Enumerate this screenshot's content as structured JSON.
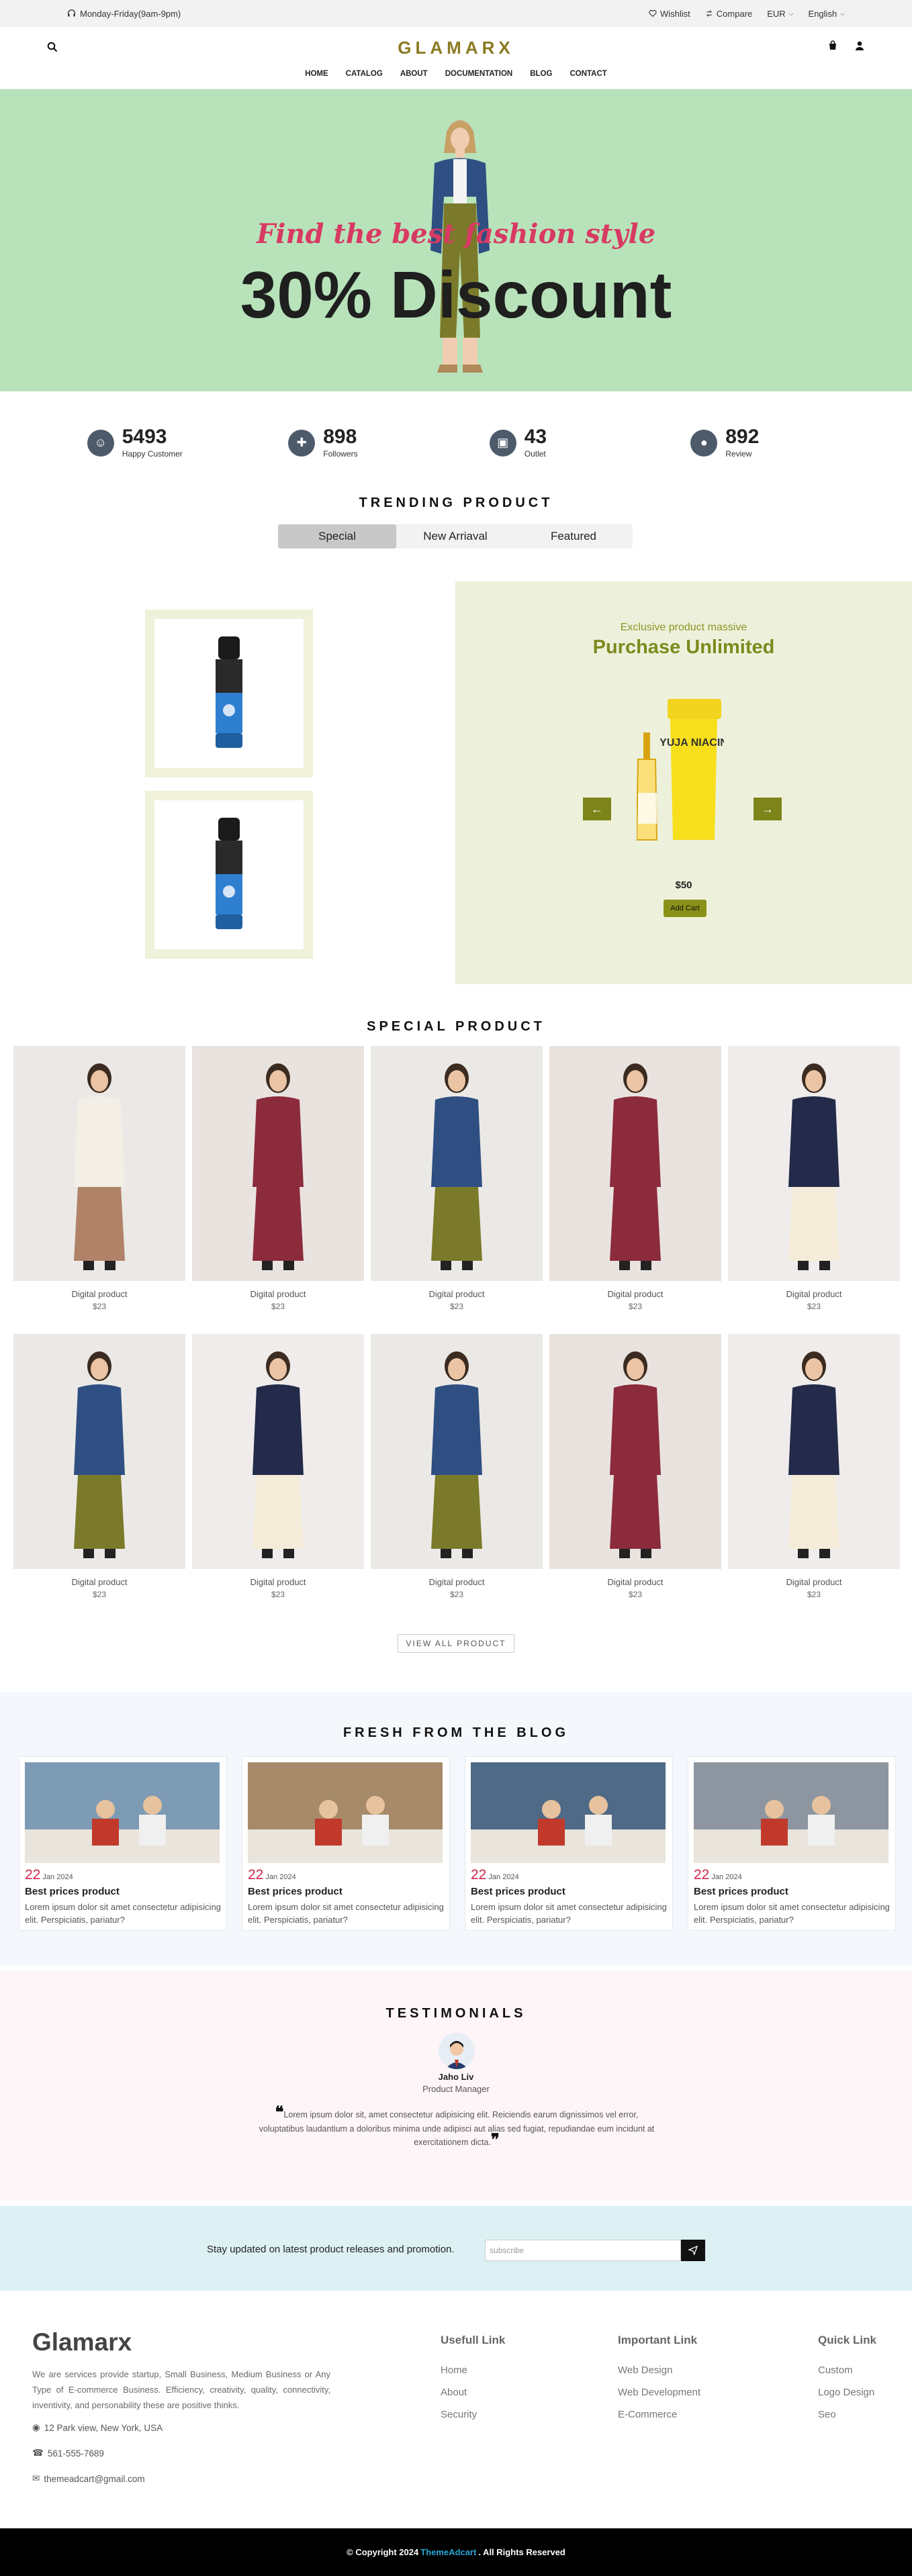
{
  "topbar": {
    "hours": "Monday-Friday(9am-9pm)",
    "wishlist": "Wishlist",
    "compare": "Compare",
    "currency": "EUR",
    "language": "English"
  },
  "header": {
    "logo": "GLAMARX",
    "nav": [
      "HOME",
      "CATALOG",
      "ABOUT",
      "DOCUMENTATION",
      "BLOG",
      "CONTACT"
    ]
  },
  "hero": {
    "tagline": "Find the best fashion style",
    "title": "30% Discount"
  },
  "stats": [
    {
      "value": "5493",
      "label": "Happy Customer",
      "icon": "smile-icon"
    },
    {
      "value": "898",
      "label": "Followers",
      "icon": "user-plus-icon"
    },
    {
      "value": "43",
      "label": "Outlet",
      "icon": "store-icon"
    },
    {
      "value": "892",
      "label": "Review",
      "icon": "chat-icon"
    }
  ],
  "trending": {
    "title": "TRENDING PRODUCT",
    "tabs": [
      "Special",
      "New Arriaval",
      "Featured"
    ],
    "promo_subtitle": "Exclusive product massive",
    "promo_title": "Purchase Unlimited",
    "product_label": "YUJA NIACIN",
    "promo_price": "$50",
    "promo_button": "Add Cart"
  },
  "special": {
    "title": "SPECIAL PRODUCT",
    "products": [
      {
        "name": "Digital product",
        "price": "$23",
        "variant": "cream"
      },
      {
        "name": "Digital product",
        "price": "$23",
        "variant": "maroon"
      },
      {
        "name": "Digital product",
        "price": "$23",
        "variant": "denim"
      },
      {
        "name": "Digital product",
        "price": "$23",
        "variant": "maroon"
      },
      {
        "name": "Digital product",
        "price": "$23",
        "variant": "navy"
      },
      {
        "name": "Digital product",
        "price": "$23",
        "variant": "denim"
      },
      {
        "name": "Digital product",
        "price": "$23",
        "variant": "navy"
      },
      {
        "name": "Digital product",
        "price": "$23",
        "variant": "denim"
      },
      {
        "name": "Digital product",
        "price": "$23",
        "variant": "maroon"
      },
      {
        "name": "Digital product",
        "price": "$23",
        "variant": "navy"
      }
    ],
    "view_all": "VIEW ALL PRODUCT"
  },
  "blog": {
    "title": "FRESH FROM THE BLOG",
    "posts": [
      {
        "day": "22",
        "month": "Jan 2024",
        "title": "Best prices product",
        "text": "Lorem ipsum dolor sit amet consectetur adipisicing elit. Perspiciatis, pariatur?"
      },
      {
        "day": "22",
        "month": "Jan 2024",
        "title": "Best prices product",
        "text": "Lorem ipsum dolor sit amet consectetur adipisicing elit. Perspiciatis, pariatur?"
      },
      {
        "day": "22",
        "month": "Jan 2024",
        "title": "Best prices product",
        "text": "Lorem ipsum dolor sit amet consectetur adipisicing elit. Perspiciatis, pariatur?"
      },
      {
        "day": "22",
        "month": "Jan 2024",
        "title": "Best prices product",
        "text": "Lorem ipsum dolor sit amet consectetur adipisicing elit. Perspiciatis, pariatur?"
      }
    ]
  },
  "testimonials": {
    "title": "TESTIMONIALS",
    "name": "Jaho Liv",
    "role": "Product Manager",
    "quote": "Lorem ipsum dolor sit, amet consectetur adipisicing elit. Reiciendis earum dignissimos vel error, voluptatibus laudantium a doloribus minima unde adipisci aut alias sed fugiat, repudiandae eum incidunt at exercitationem dicta."
  },
  "subscribe": {
    "text": "Stay updated on latest product releases and promotion.",
    "placeholder": "subscribe"
  },
  "footer": {
    "brand": "Glamarx",
    "description": "We are services provide startup, Small Business, Medium Business or Any Type of E-commerce Business. Efficiency, creativity, quality, connectivity, inventivity, and personability these are positive thinks.",
    "address": "12 Park view, New York, USA",
    "phone": "561-555-7689",
    "email": "themeadcart@gmail.com",
    "cols": [
      {
        "title": "Usefull Link",
        "links": [
          "Home",
          "About",
          "Security"
        ]
      },
      {
        "title": "Important Link",
        "links": [
          "Web Design",
          "Web Development",
          "E-Commerce"
        ]
      },
      {
        "title": "Quick Link",
        "links": [
          "Custom",
          "Logo Design",
          "Seo"
        ]
      }
    ],
    "copyright_pre": "© Copyright 2024",
    "copyright_brand": "ThemeAdcart",
    "copyright_post": ". All Rights Reserved"
  },
  "colors": {
    "hero_bg": "#b8e3ba",
    "accent_olive": "#7d8a1e",
    "hero_tag": "#d83a63",
    "blog_date": "#d4254a"
  }
}
